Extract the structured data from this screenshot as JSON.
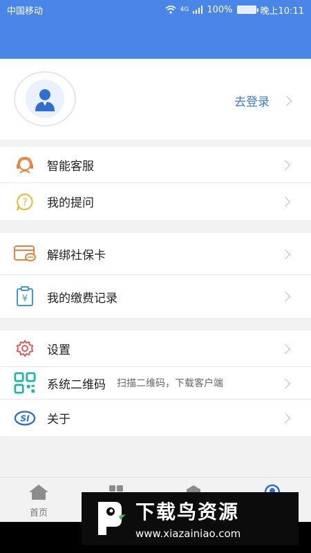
{
  "status_bar": {
    "carrier": "中国移动",
    "network": "4G",
    "battery": "100%",
    "time": "晚上10:11"
  },
  "profile": {
    "login_label": "去登录"
  },
  "menu": {
    "group1": [
      {
        "label": "智能客服",
        "icon": "headset-icon"
      },
      {
        "label": "我的提问",
        "icon": "question-icon"
      }
    ],
    "group2": [
      {
        "label": "解绑社保卡",
        "icon": "card-icon"
      },
      {
        "label": "我的缴费记录",
        "icon": "payment-record-icon"
      }
    ],
    "group3": [
      {
        "label": "设置",
        "icon": "gear-icon"
      },
      {
        "label": "系统二维码",
        "sub": "扫描二维码，下载客户端",
        "icon": "qrcode-icon"
      },
      {
        "label": "关于",
        "icon": "si-logo-icon"
      }
    ]
  },
  "tabbar": {
    "items": [
      {
        "label": "首页",
        "icon": "home-icon"
      }
    ]
  },
  "watermark": {
    "title": "下载鸟资源",
    "url": "www.xiazainiao.com"
  },
  "colors": {
    "primary": "#4a86e8",
    "link": "#3a7bd5"
  }
}
